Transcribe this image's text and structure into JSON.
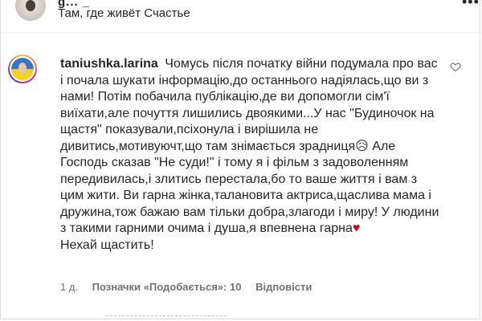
{
  "post_header": {
    "username_partial": "g... _",
    "location": "Там, где живёт Счастье",
    "more_label": "•••"
  },
  "comment": {
    "username": "taniushka.larina",
    "text": "Чомусь після початку війни подумала про вас і почала шукати інформацію,до останнього надіялась,що ви з нами! Потім побачила публікацію,де ви допомогли сім'ї виїхати,але почуття лишились двоякими...У нас \"Будиночок на щастя\" показували,псіхонула і вирішила не дивитись,мотивуючт,що там знімається зрадниця😥 Але Господь сказав \"Не суди!\" і тому я і фільм з задоволенням передивилась,і злитись перестала,бо то ваше життя і вам з цим жити. Ви гарна жінка,талановита актриса,щаслива мама і дружина,тож бажаю вам тільки добра,злагоди і миру! У людини з такими гарними очима і душа,я впевнена гарна",
    "heart_emoji": "♥",
    "text_end": "Нехай щастить!",
    "age": "1 д.",
    "likes": "Позначки «Подобається»: 10",
    "reply_label": "Відповісти"
  },
  "colors": {
    "text": "#262626",
    "meta": "#737373",
    "heart": "#d0021b"
  }
}
